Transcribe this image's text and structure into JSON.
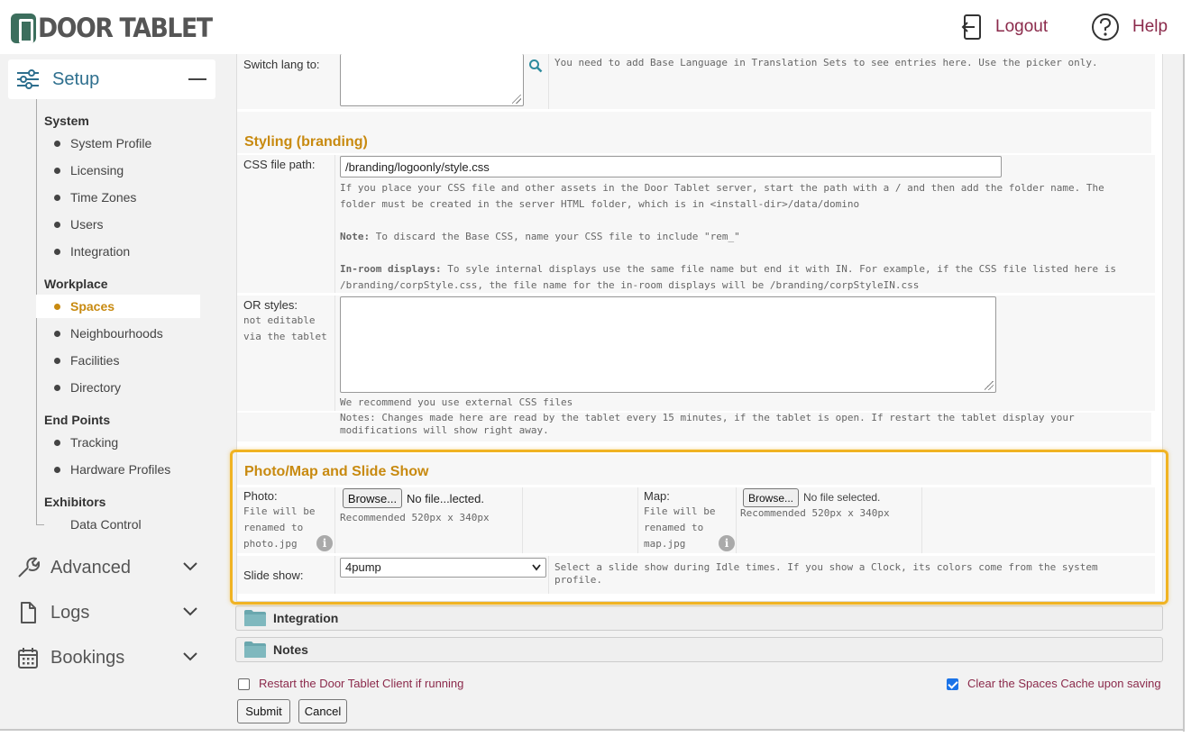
{
  "header": {
    "logo_text": "DOOR TABLET",
    "logout_label": "Logout",
    "help_label": "Help"
  },
  "sidebar": {
    "setup_label": "Setup",
    "sections": {
      "system": "System",
      "workplace": "Workplace",
      "endpoints": "End Points",
      "exhibitors": "Exhibitors"
    },
    "items": {
      "system_profile": "System Profile",
      "licensing": "Licensing",
      "time_zones": "Time Zones",
      "users": "Users",
      "integration": "Integration",
      "spaces": "Spaces",
      "neighbourhoods": "Neighbourhoods",
      "facilities": "Facilities",
      "directory": "Directory",
      "tracking": "Tracking",
      "hardware_profiles": "Hardware Profiles",
      "data_control": "Data Control"
    },
    "nav": {
      "advanced": "Advanced",
      "logs": "Logs",
      "bookings": "Bookings"
    }
  },
  "form": {
    "switch_lang": {
      "label": "Switch lang to:",
      "hint": "You need to add Base Language in Translation Sets to see entries here.  Use the picker only."
    },
    "styling": {
      "title": "Styling (branding)",
      "css_label": "CSS file path:",
      "css_value": "/branding/logoonly/style.css",
      "css_help_1": "If you place your CSS file and other assets in the Door Tablet server, start the path with a / and then add the folder name. The",
      "css_help_2": "folder must be created in the server HTML folder, which is in <install-dir>/data/domino",
      "note_label": "Note:",
      "note_text": "To discard the Base CSS, name your CSS file to include \"rem_\"",
      "inroom_label": "In-room displays:",
      "inroom_text_1": "To syle internal displays use the same file name but end it with IN. For example, if the CSS file listed here is",
      "inroom_text_2": "/branding/corpStyle.css, the file name for the in-room displays will be /branding/corpStyleIN.css",
      "or_styles_label": "OR styles:",
      "or_styles_sub_1": "not editable",
      "or_styles_sub_2": "via the tablet",
      "recommend": "We recommend you use external CSS files",
      "notes_1": "Notes: Changes made here are read by the tablet every 15 minutes, if the tablet is open. If restart the tablet display your",
      "notes_2": "modifications will show right away."
    },
    "photo_map": {
      "title": "Photo/Map and Slide Show",
      "photo_label": "Photo:",
      "photo_sub_1": "File will be",
      "photo_sub_2": "renamed to",
      "photo_sub_3": "photo.jpg",
      "browse_label": "Browse...",
      "photo_file_status": "No file...lected.",
      "photo_recommend": "Recommended 520px x 340px",
      "map_label": "Map:",
      "map_sub_1": "File will be",
      "map_sub_2": "renamed to",
      "map_sub_3": "map.jpg",
      "map_file_status": "No file selected.",
      "map_recommend": "Recommended 520px x 340px",
      "slideshow_label": "Slide show:",
      "slideshow_value": "4pump",
      "slideshow_hint_1": "Select a slide show during Idle times. If you show a Clock, its colors come from the system",
      "slideshow_hint_2": "profile."
    },
    "collapsed": {
      "integration": "Integration",
      "notes": "Notes"
    },
    "options": {
      "restart_label": "Restart the Door Tablet Client if running",
      "restart_checked": false,
      "clear_cache_label": "Clear the Spaces Cache upon saving",
      "clear_cache_checked": true
    },
    "buttons": {
      "submit": "Submit",
      "cancel": "Cancel"
    }
  },
  "colors": {
    "accent": "#c88a10",
    "link": "#8b2a4b",
    "highlight": "#f0b323",
    "setup_text": "#2e6f8e"
  }
}
